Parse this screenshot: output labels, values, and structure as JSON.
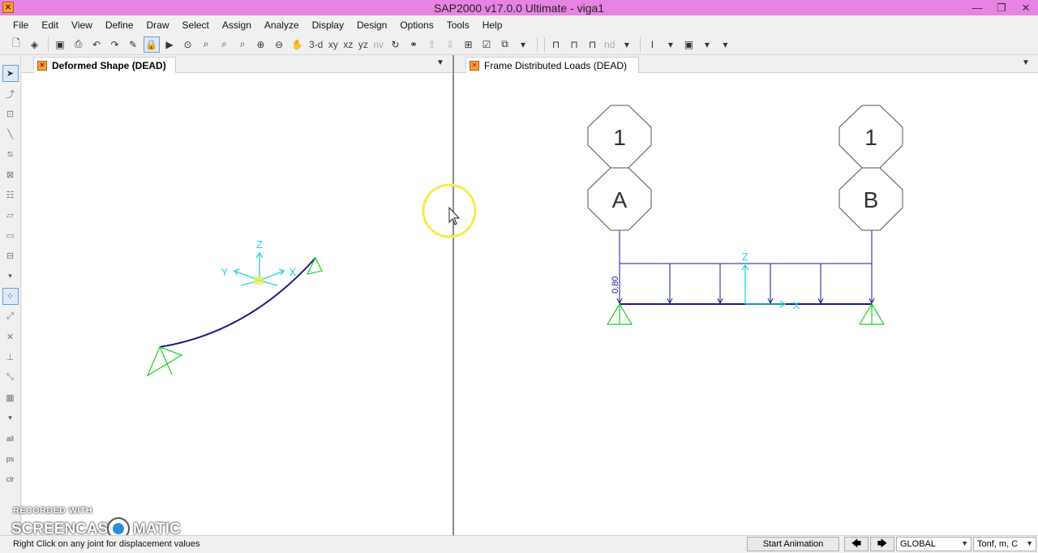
{
  "window": {
    "title": "SAP2000 v17.0.0 Ultimate  - viga1",
    "minimize": "—",
    "restore": "❐",
    "close": "✕"
  },
  "menu": [
    "File",
    "Edit",
    "View",
    "Define",
    "Draw",
    "Select",
    "Assign",
    "Analyze",
    "Display",
    "Design",
    "Options",
    "Tools",
    "Help"
  ],
  "toolbar": {
    "view_3d": "3-d",
    "view_xy": "xy",
    "view_xz": "xz",
    "view_yz": "yz",
    "view_nv": "nv",
    "nd": "nd"
  },
  "left_strip": {
    "all": "all",
    "ps": "ps",
    "clr": "clr"
  },
  "pane_left": {
    "tab_title": "Deformed Shape (DEAD)",
    "axes": {
      "z": "Z",
      "y": "Y",
      "x": "X"
    }
  },
  "pane_right": {
    "tab_title": "Frame Distributed Loads (DEAD)",
    "grid_bubbles": {
      "top_left": "1",
      "top_right": "1",
      "label_left": "A",
      "label_right": "B"
    },
    "load_value": "0.80",
    "axes": {
      "z": "Z",
      "x": "X"
    }
  },
  "watermark": {
    "recorded_with": "RECORDED WITH",
    "brand_left": "SCREENCAST",
    "brand_right": "MATIC"
  },
  "status": {
    "message": "Right Click on any joint for displacement values",
    "start_animation": "Start Animation",
    "prev_arrow": "🡄",
    "next_arrow": "🡆",
    "coord_system": "GLOBAL",
    "units": "Tonf, m, C"
  },
  "colors": {
    "title_bar": "#e783e3",
    "member": "#1a1a8c",
    "support": "#22cc22",
    "axis": "#22d0e0",
    "cursor_highlight": "#f4ec4a"
  }
}
